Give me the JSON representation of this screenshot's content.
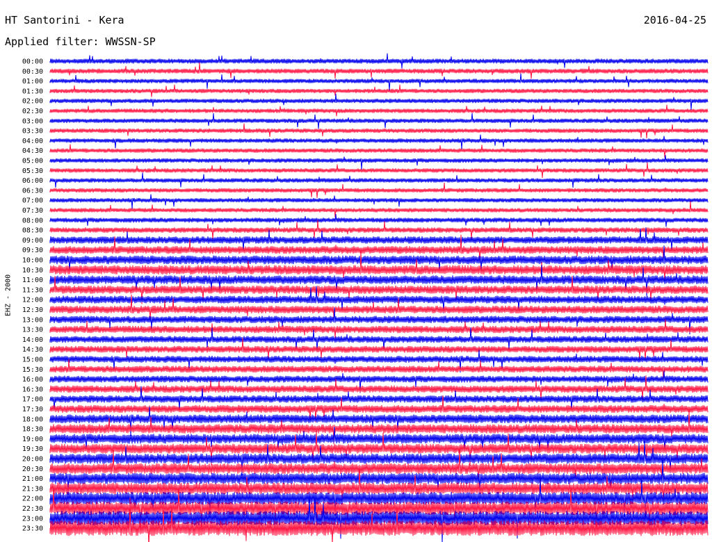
{
  "header": {
    "station": "HT Santorini - Kera",
    "date": "2016-04-25",
    "filter_label": "Applied filter: WWSSN-SP"
  },
  "chart_data": {
    "type": "seismogram-helicorder",
    "ylabel": "EHZ - 2000",
    "time_labels": [
      "00:00",
      "00:30",
      "01:00",
      "01:30",
      "02:00",
      "02:30",
      "03:00",
      "03:30",
      "04:00",
      "04:30",
      "05:00",
      "05:30",
      "06:00",
      "06:30",
      "07:00",
      "07:30",
      "08:00",
      "08:30",
      "09:00",
      "09:30",
      "10:00",
      "10:30",
      "11:00",
      "11:30",
      "12:00",
      "12:30",
      "13:00",
      "13:30",
      "14:00",
      "14:30",
      "15:00",
      "15:30",
      "16:00",
      "16:30",
      "17:00",
      "17:30",
      "18:00",
      "18:30",
      "19:00",
      "19:30",
      "20:00",
      "20:30",
      "21:00",
      "21:30",
      "22:00",
      "22:30",
      "23:00",
      "23:30"
    ],
    "trace_colors": [
      "#0000ee",
      "#ff1744"
    ],
    "relative_amplitude": [
      0.5,
      0.5,
      0.45,
      0.45,
      0.45,
      0.45,
      0.45,
      0.45,
      0.45,
      0.45,
      0.45,
      0.45,
      0.45,
      0.45,
      0.45,
      0.45,
      0.5,
      0.55,
      0.75,
      0.8,
      0.9,
      0.95,
      0.9,
      0.85,
      0.8,
      0.8,
      0.75,
      0.75,
      0.7,
      0.7,
      0.7,
      0.7,
      0.7,
      0.75,
      0.75,
      0.8,
      0.9,
      0.95,
      1.0,
      1.0,
      1.05,
      1.1,
      1.15,
      1.2,
      1.3,
      1.4,
      1.5,
      1.6
    ]
  }
}
